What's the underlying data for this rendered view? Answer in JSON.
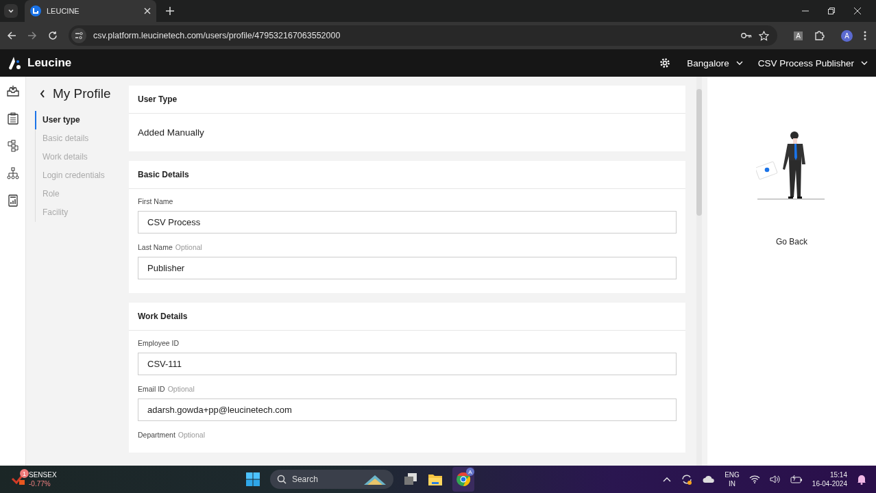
{
  "browser": {
    "tab_title": "LEUCINE",
    "url": "csv.platform.leucinetech.com/users/profile/479532167063552000",
    "extension_letter": "A",
    "profile_letter": "A"
  },
  "app_header": {
    "brand": "Leucine",
    "facility": "Bangalore",
    "user": "CSV Process Publisher"
  },
  "page": {
    "title": "My Profile"
  },
  "nav_items": [
    {
      "label": "User type",
      "selected": true
    },
    {
      "label": "Basic details",
      "selected": false
    },
    {
      "label": "Work details",
      "selected": false
    },
    {
      "label": "Login credentials",
      "selected": false
    },
    {
      "label": "Role",
      "selected": false
    },
    {
      "label": "Facility",
      "selected": false
    }
  ],
  "sections": [
    {
      "title": "User Type",
      "kind": "text",
      "value": "Added Manually"
    },
    {
      "title": "Basic Details",
      "kind": "fields",
      "fields": [
        {
          "label": "First Name",
          "value": "CSV Process"
        },
        {
          "label": "Last Name",
          "optional": "Optional",
          "value": "Publisher"
        }
      ]
    },
    {
      "title": "Work Details",
      "kind": "fields",
      "fields": [
        {
          "label": "Employee ID",
          "value": "CSV-111"
        },
        {
          "label": "Email ID",
          "optional": "Optional",
          "value": "adarsh.gowda+pp@leucinetech.com"
        },
        {
          "label": "Department",
          "optional": "Optional"
        }
      ]
    }
  ],
  "side_panel": {
    "link": "Go Back"
  },
  "taskbar": {
    "ticker_badge": "1",
    "ticker_name": "SENSEX",
    "ticker_change": "-0.77%",
    "search": "Search",
    "chrome_badge": "A",
    "lang": "ENG",
    "region": "IN",
    "time": "15:14",
    "date": "16-04-2024"
  }
}
